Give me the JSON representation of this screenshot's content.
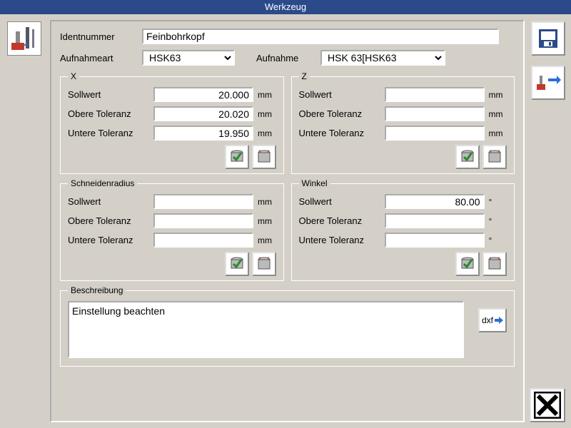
{
  "title": "Werkzeug",
  "header": {
    "ident_label": "Identnummer",
    "ident_value": "Feinbohrkopf",
    "aufnahmeart_label": "Aufnahmeart",
    "aufnahmeart_value": "HSK63",
    "aufnahme_label": "Aufnahme",
    "aufnahme_value": "HSK 63[HSK63"
  },
  "groups": {
    "x": {
      "legend": "X",
      "sollwert_label": "Sollwert",
      "sollwert_value": "20.000",
      "obere_label": "Obere Toleranz",
      "obere_value": "20.020",
      "untere_label": "Untere Toleranz",
      "untere_value": "19.950",
      "unit": "mm"
    },
    "z": {
      "legend": "Z",
      "sollwert_label": "Sollwert",
      "sollwert_value": "",
      "obere_label": "Obere Toleranz",
      "obere_value": "",
      "untere_label": "Untere Toleranz",
      "untere_value": "",
      "unit": "mm"
    },
    "radius": {
      "legend": "Schneidenradius",
      "sollwert_label": "Sollwert",
      "sollwert_value": "",
      "obere_label": "Obere Toleranz",
      "obere_value": "",
      "untere_label": "Untere Toleranz",
      "untere_value": "",
      "unit": "mm"
    },
    "winkel": {
      "legend": "Winkel",
      "sollwert_label": "Sollwert",
      "sollwert_value": "80.00",
      "obere_label": "Obere Toleranz",
      "obere_value": "",
      "untere_label": "Untere Toleranz",
      "untere_value": "",
      "unit": "°"
    }
  },
  "description": {
    "legend": "Beschreibung",
    "text": "Einstellung beachten",
    "dxf_label": "dxf"
  }
}
